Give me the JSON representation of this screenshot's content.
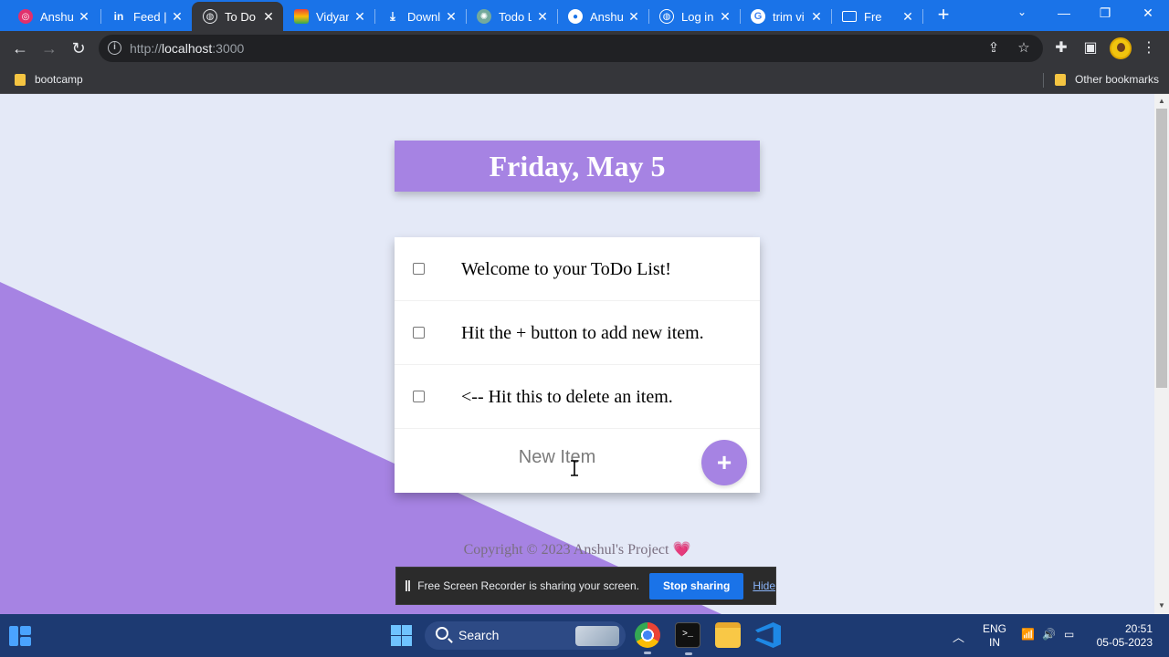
{
  "browser": {
    "tabs": [
      {
        "title": "Anshul",
        "favicon": "instagram-icon",
        "color": "#e1306c"
      },
      {
        "title": "Feed |",
        "favicon": "linkedin-icon",
        "color": "#0a66c2"
      },
      {
        "title": "To Do",
        "favicon": "globe-icon",
        "color": "#9aa0a6",
        "active": true
      },
      {
        "title": "Vidyan",
        "favicon": "rainbow-icon",
        "color": "#f4b400"
      },
      {
        "title": "Downl",
        "favicon": "download-icon",
        "color": "#ffffff"
      },
      {
        "title": "Todo L",
        "favicon": "openai-icon",
        "color": "#74aa9c"
      },
      {
        "title": "Anshul",
        "favicon": "github-icon",
        "color": "#ffffff"
      },
      {
        "title": "Log in",
        "favicon": "globe-icon",
        "color": "#ffffff"
      },
      {
        "title": "trim vi",
        "favicon": "google-icon",
        "color": "#ffffff"
      },
      {
        "title": "Fre",
        "favicon": "screen-recorder-icon",
        "color": "#ffffff"
      }
    ],
    "url_scheme": "http://",
    "url_host": "localhost",
    "url_port": ":3000",
    "bookmarks": [
      {
        "label": "bootcamp"
      },
      {
        "label": "Other bookmarks"
      }
    ],
    "accent": "#1a73e8"
  },
  "app": {
    "heading": "Friday, May 5",
    "items": [
      {
        "text": "Welcome to your ToDo List!",
        "checked": false
      },
      {
        "text": "Hit the + button to add new item.",
        "checked": false
      },
      {
        "text": "<-- Hit this to delete an item.",
        "checked": false
      }
    ],
    "new_item_placeholder": "New Item",
    "add_button_label": "+",
    "footer": "Copyright © 2023 Anshul's Project",
    "footer_heart": "💗",
    "accent": "#a683e3"
  },
  "share_bar": {
    "message": "Free Screen Recorder is sharing your screen.",
    "stop_label": "Stop sharing",
    "hide_label": "Hide"
  },
  "taskbar": {
    "search_label": "Search",
    "lang_line1": "ENG",
    "lang_line2": "IN",
    "time": "20:51",
    "date": "05-05-2023"
  }
}
